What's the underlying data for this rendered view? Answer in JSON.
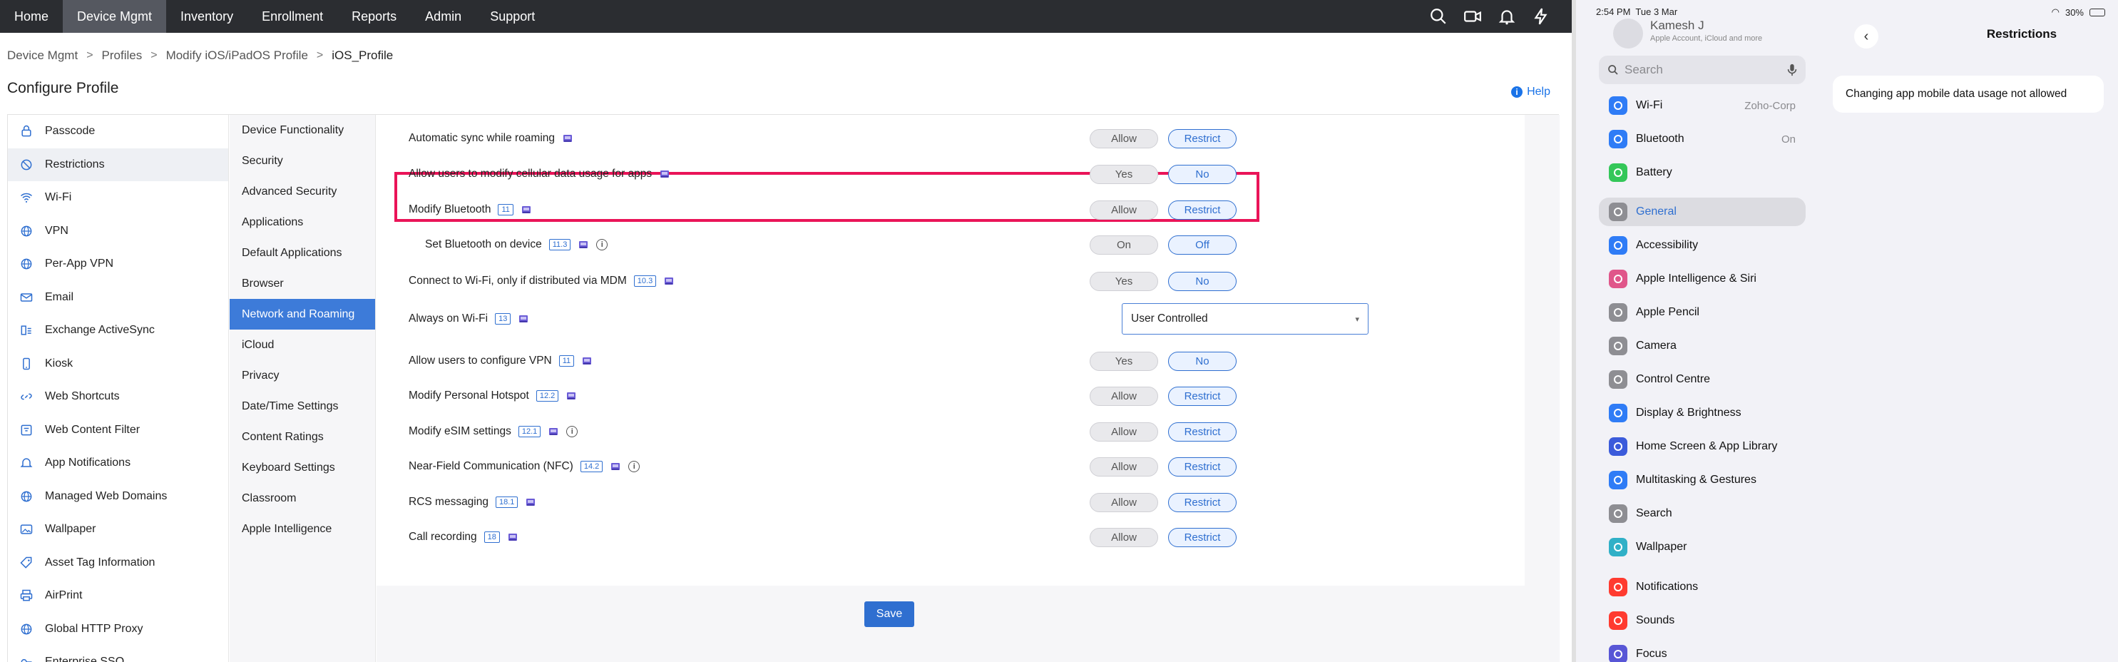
{
  "nav": {
    "items": [
      "Home",
      "Device Mgmt",
      "Inventory",
      "Enrollment",
      "Reports",
      "Admin",
      "Support"
    ],
    "active_index": 1
  },
  "breadcrumb": {
    "items": [
      "Device Mgmt",
      "Profiles",
      "Modify iOS/iPadOS Profile",
      "iOS_Profile"
    ],
    "sep": ">"
  },
  "page_title": "Configure Profile",
  "help_label": "Help",
  "categories": [
    "Passcode",
    "Restrictions",
    "Wi-Fi",
    "VPN",
    "Per-App VPN",
    "Email",
    "Exchange ActiveSync",
    "Kiosk",
    "Web Shortcuts",
    "Web Content Filter",
    "App Notifications",
    "Managed Web Domains",
    "Wallpaper",
    "Asset Tag Information",
    "AirPrint",
    "Global HTTP Proxy",
    "Enterprise SSO"
  ],
  "active_category": "Restrictions",
  "subcategories": [
    "Device Functionality",
    "Security",
    "Advanced Security",
    "Applications",
    "Default Applications",
    "Browser",
    "Network and Roaming",
    "iCloud",
    "Privacy",
    "Date/Time Settings",
    "Content Ratings",
    "Keyboard Settings",
    "Classroom",
    "Apple Intelligence"
  ],
  "active_subcategory": "Network and Roaming",
  "settings": [
    {
      "label": "Automatic sync while roaming",
      "badge": "",
      "info": false,
      "opt1": "Allow",
      "opt2": "Restrict",
      "selected": "opt2"
    },
    {
      "label": "Allow users to modify cellular data usage for apps",
      "badge": "",
      "info": false,
      "opt1": "Yes",
      "opt2": "No",
      "selected": "opt2"
    },
    {
      "label": "Modify Bluetooth",
      "badge": "11",
      "info": false,
      "opt1": "Allow",
      "opt2": "Restrict",
      "selected": "opt2"
    },
    {
      "label": "Set Bluetooth on device",
      "badge": "11.3",
      "info": true,
      "opt1": "On",
      "opt2": "Off",
      "selected": "opt2"
    },
    {
      "label": "Connect to Wi-Fi, only if distributed via MDM",
      "badge": "10.3",
      "info": false,
      "opt1": "Yes",
      "opt2": "No",
      "selected": "opt2"
    },
    {
      "label": "Always on Wi-Fi",
      "badge": "13",
      "info": false,
      "select": "User Controlled"
    },
    {
      "label": "Allow users to configure VPN",
      "badge": "11",
      "info": false,
      "opt1": "Yes",
      "opt2": "No",
      "selected": "opt2"
    },
    {
      "label": "Modify Personal Hotspot",
      "badge": "12.2",
      "info": false,
      "opt1": "Allow",
      "opt2": "Restrict",
      "selected": "opt2"
    },
    {
      "label": "Modify eSIM settings",
      "badge": "12.1",
      "info": true,
      "opt1": "Allow",
      "opt2": "Restrict",
      "selected": "opt2"
    },
    {
      "label": "Near-Field Communication (NFC)",
      "badge": "14.2",
      "info": true,
      "opt1": "Allow",
      "opt2": "Restrict",
      "selected": "opt2"
    },
    {
      "label": "RCS messaging",
      "badge": "18.1",
      "info": false,
      "opt1": "Allow",
      "opt2": "Restrict",
      "selected": "opt2"
    },
    {
      "label": "Call recording",
      "badge": "18",
      "info": false,
      "opt1": "Allow",
      "opt2": "Restrict",
      "selected": "opt2"
    }
  ],
  "save_label": "Save",
  "ipad": {
    "time": "2:54 PM",
    "date": "Tue 3 Mar",
    "battery": "30%",
    "profile_name": "Kamesh J",
    "profile_sub": "Apple Account, iCloud and more",
    "search_placeholder": "Search",
    "items": [
      {
        "label": "Wi-Fi",
        "value": "Zoho-Corp",
        "color": "#2f7cf6"
      },
      {
        "label": "Bluetooth",
        "value": "On",
        "color": "#2f7cf6"
      },
      {
        "label": "Battery",
        "value": "",
        "color": "#34c759"
      },
      {
        "label": "General",
        "value": "",
        "color": "#8e8e93"
      },
      {
        "label": "Accessibility",
        "value": "",
        "color": "#2f7cf6"
      },
      {
        "label": "Apple Intelligence & Siri",
        "value": "",
        "color": "#e0568a"
      },
      {
        "label": "Apple Pencil",
        "value": "",
        "color": "#8e8e93"
      },
      {
        "label": "Camera",
        "value": "",
        "color": "#8e8e93"
      },
      {
        "label": "Control Centre",
        "value": "",
        "color": "#8e8e93"
      },
      {
        "label": "Display & Brightness",
        "value": "",
        "color": "#2f7cf6"
      },
      {
        "label": "Home Screen & App Library",
        "value": "",
        "color": "#3b5bdb"
      },
      {
        "label": "Multitasking & Gestures",
        "value": "",
        "color": "#2f7cf6"
      },
      {
        "label": "Search",
        "value": "",
        "color": "#8e8e93"
      },
      {
        "label": "Wallpaper",
        "value": "",
        "color": "#30b0c7"
      },
      {
        "label": "Notifications",
        "value": "",
        "color": "#ff3b30"
      },
      {
        "label": "Sounds",
        "value": "",
        "color": "#ff3b30"
      },
      {
        "label": "Focus",
        "value": "",
        "color": "#5856d6"
      }
    ],
    "selected_item": "General",
    "detail_title": "Restrictions",
    "detail_message": "Changing app mobile data usage not allowed"
  },
  "colors": {
    "accent": "#2f6fd0",
    "highlight": "#ea1458",
    "nav_bg": "#2b2d31"
  }
}
